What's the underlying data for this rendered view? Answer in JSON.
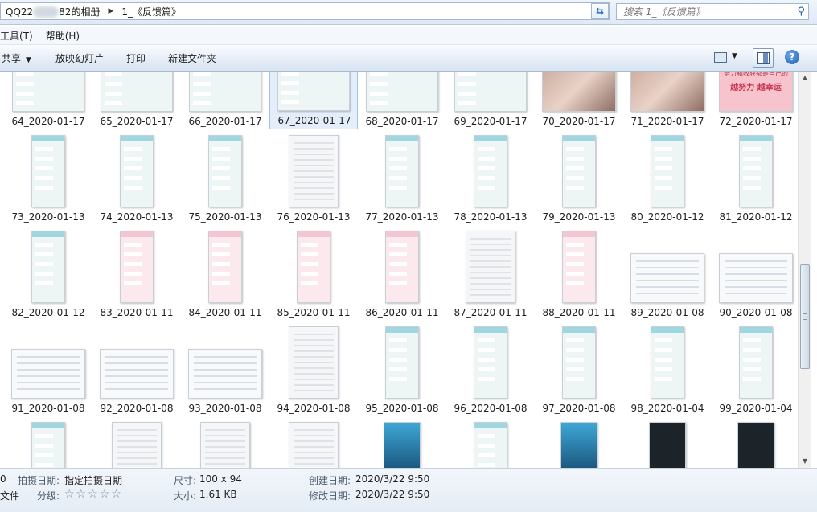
{
  "address": {
    "segment_prefix": "QQ22",
    "segment_suffix": "82的相册",
    "current_folder": "1_《反馈篇》"
  },
  "search": {
    "placeholder": "搜索 1_《反馈篇》"
  },
  "menu": {
    "items": [
      "工具(T)",
      "帮助(H)"
    ]
  },
  "toolbar": {
    "share_label": "共享",
    "slideshow_label": "放映幻灯片",
    "print_label": "打印",
    "new_folder_label": "新建文件夹"
  },
  "files": [
    {
      "name": "64_2020-01-17",
      "kind": "chat"
    },
    {
      "name": "65_2020-01-17",
      "kind": "chat"
    },
    {
      "name": "66_2020-01-17",
      "kind": "chat"
    },
    {
      "name": "67_2020-01-17",
      "kind": "chat",
      "selected": true
    },
    {
      "name": "68_2020-01-17",
      "kind": "chat"
    },
    {
      "name": "69_2020-01-17",
      "kind": "chat"
    },
    {
      "name": "70_2020-01-17",
      "kind": "photo"
    },
    {
      "name": "71_2020-01-17",
      "kind": "photo"
    },
    {
      "name": "72_2020-01-17",
      "kind": "pinkbanner",
      "banner_text": "努力和收获都是自己的",
      "banner_text2": "越努力 越幸运"
    },
    {
      "name": "73_2020-01-13",
      "kind": "chat"
    },
    {
      "name": "74_2020-01-13",
      "kind": "chat"
    },
    {
      "name": "75_2020-01-13",
      "kind": "chat"
    },
    {
      "name": "76_2020-01-13",
      "kind": "tall"
    },
    {
      "name": "77_2020-01-13",
      "kind": "chat"
    },
    {
      "name": "78_2020-01-13",
      "kind": "chat"
    },
    {
      "name": "79_2020-01-13",
      "kind": "chat"
    },
    {
      "name": "80_2020-01-12",
      "kind": "chat"
    },
    {
      "name": "81_2020-01-12",
      "kind": "chat"
    },
    {
      "name": "82_2020-01-12",
      "kind": "chat"
    },
    {
      "name": "83_2020-01-11",
      "kind": "pink"
    },
    {
      "name": "84_2020-01-11",
      "kind": "pink"
    },
    {
      "name": "85_2020-01-11",
      "kind": "pink"
    },
    {
      "name": "86_2020-01-11",
      "kind": "pink"
    },
    {
      "name": "87_2020-01-11",
      "kind": "tall"
    },
    {
      "name": "88_2020-01-11",
      "kind": "pink"
    },
    {
      "name": "89_2020-01-08",
      "kind": "wide"
    },
    {
      "name": "90_2020-01-08",
      "kind": "wide"
    },
    {
      "name": "91_2020-01-08",
      "kind": "wide"
    },
    {
      "name": "92_2020-01-08",
      "kind": "wide"
    },
    {
      "name": "93_2020-01-08",
      "kind": "wide"
    },
    {
      "name": "94_2020-01-08",
      "kind": "tall"
    },
    {
      "name": "95_2020-01-08",
      "kind": "chat"
    },
    {
      "name": "96_2020-01-08",
      "kind": "chat"
    },
    {
      "name": "97_2020-01-08",
      "kind": "chat"
    },
    {
      "name": "98_2020-01-04",
      "kind": "chat"
    },
    {
      "name": "99_2020-01-04",
      "kind": "chat"
    },
    {
      "name": "",
      "kind": "chat"
    },
    {
      "name": "",
      "kind": "tall"
    },
    {
      "name": "",
      "kind": "tall"
    },
    {
      "name": "",
      "kind": "tall"
    },
    {
      "name": "",
      "kind": "blue"
    },
    {
      "name": "",
      "kind": "chat"
    },
    {
      "name": "",
      "kind": "blue"
    },
    {
      "name": "",
      "kind": "dark"
    },
    {
      "name": "",
      "kind": "dark"
    }
  ],
  "details": {
    "left_partial_1": "0",
    "left_partial_2": "文件",
    "date_taken_label": "拍摄日期:",
    "date_taken_value": "指定拍摄日期",
    "rating_label": "分级:",
    "rating_stars": 0,
    "dimensions_label": "尺寸:",
    "dimensions_value": "100 x 94",
    "size_label": "大小:",
    "size_value": "1.61 KB",
    "created_label": "创建日期:",
    "created_value": "2020/3/22 9:50",
    "modified_label": "修改日期:",
    "modified_value": "2020/3/22 9:50"
  }
}
